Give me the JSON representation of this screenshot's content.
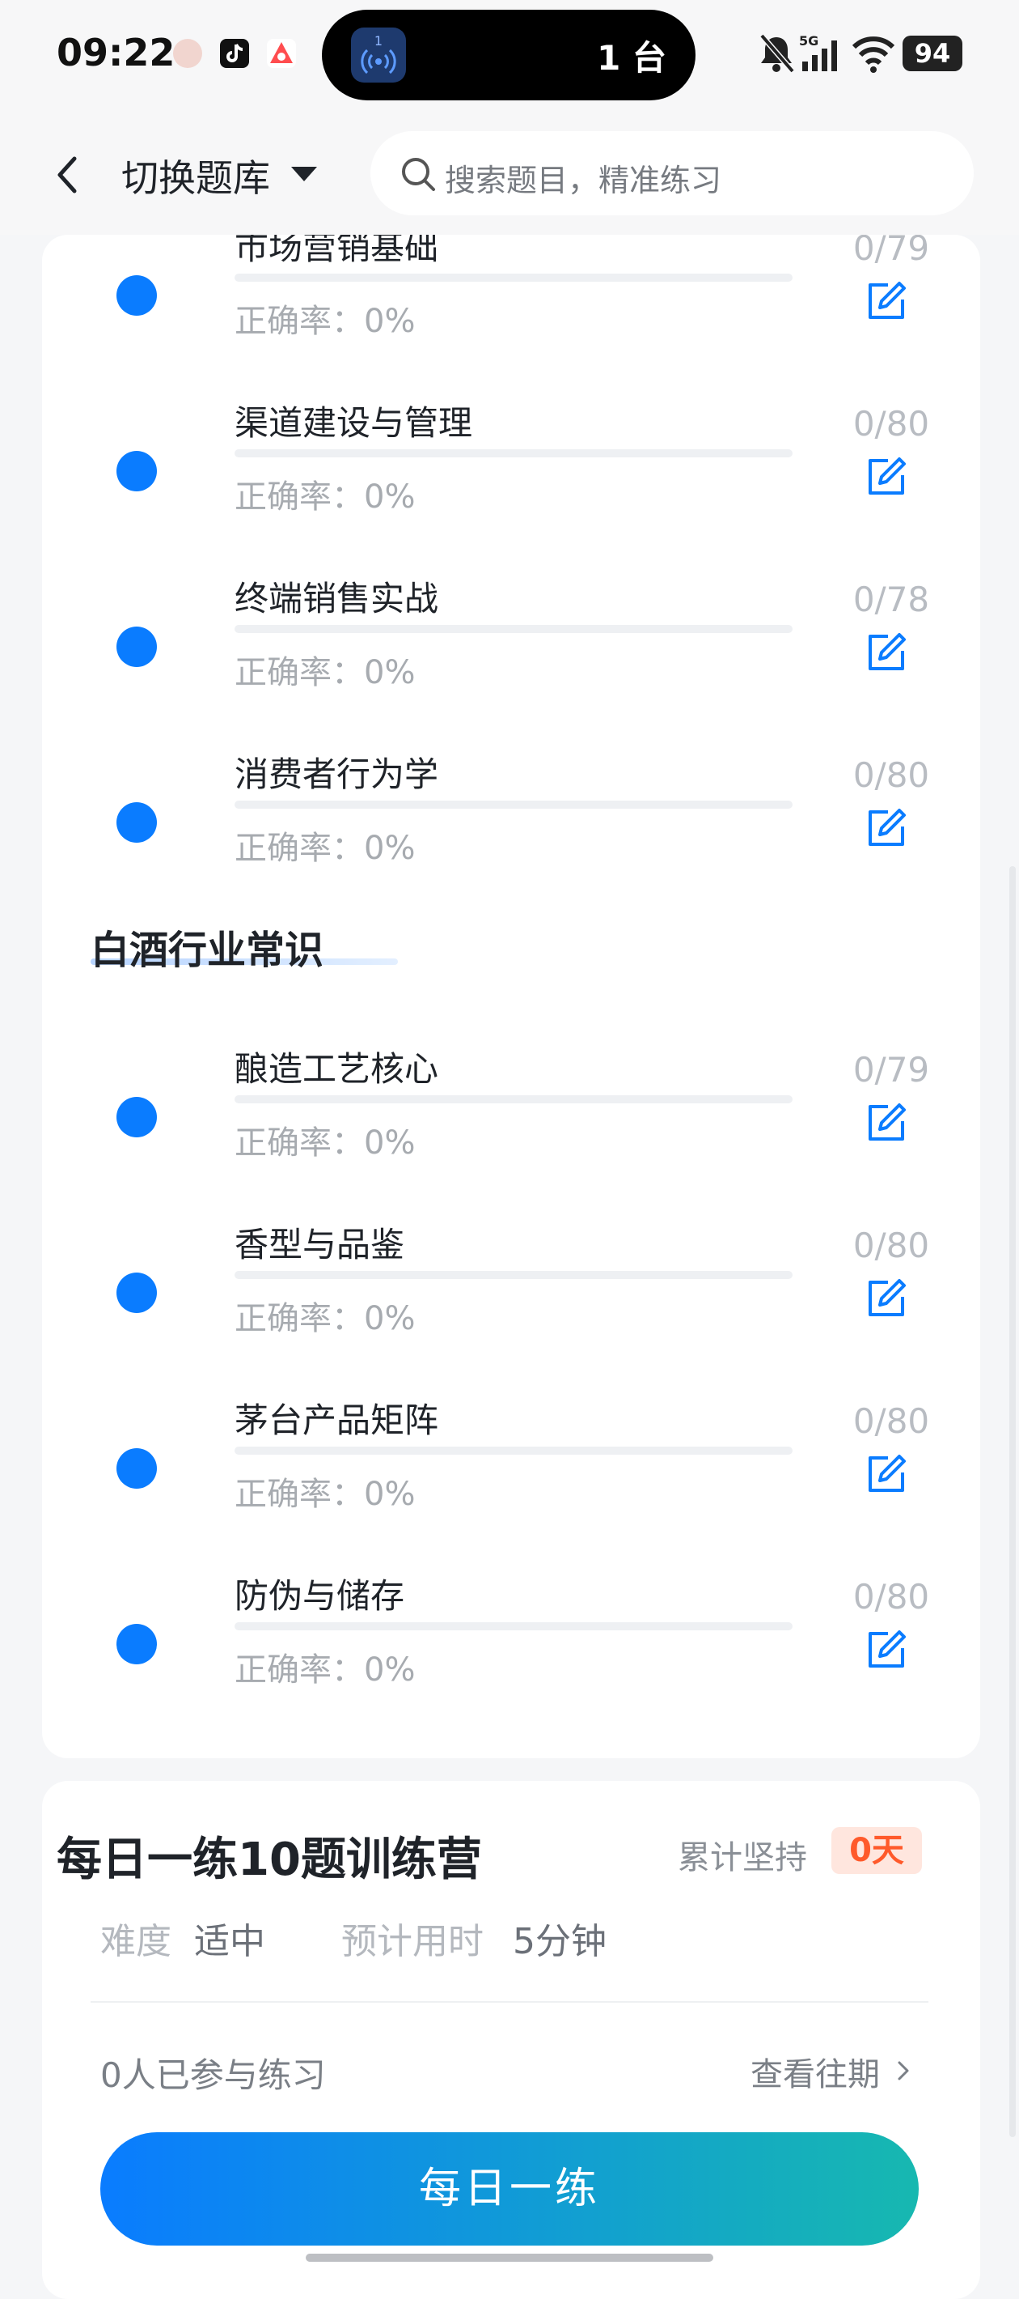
{
  "status_bar": {
    "time": "09:22",
    "island_text": "1 台",
    "island_badge": "1",
    "signal_label": "5G",
    "battery": "94"
  },
  "header": {
    "switch_label": "切换题库",
    "search_placeholder": "搜索题目，精准练习"
  },
  "topics_partial": [
    {
      "title": "市场营销基础",
      "accuracy_label": "正确率：0%",
      "count": "0/79"
    },
    {
      "title": "渠道建设与管理",
      "accuracy_label": "正确率：0%",
      "count": "0/80"
    },
    {
      "title": "终端销售实战",
      "accuracy_label": "正确率：0%",
      "count": "0/78"
    },
    {
      "title": "消费者行为学",
      "accuracy_label": "正确率：0%",
      "count": "0/80"
    }
  ],
  "section": {
    "title": "白酒行业常识",
    "items": [
      {
        "title": "酿造工艺核心",
        "accuracy_label": "正确率：0%",
        "count": "0/79"
      },
      {
        "title": "香型与品鉴",
        "accuracy_label": "正确率：0%",
        "count": "0/80"
      },
      {
        "title": "茅台产品矩阵",
        "accuracy_label": "正确率：0%",
        "count": "0/80"
      },
      {
        "title": "防伪与储存",
        "accuracy_label": "正确率：0%",
        "count": "0/80"
      }
    ]
  },
  "daily": {
    "title": "每日一练10题训练营",
    "persist_label": "累计坚持",
    "days": "0天",
    "difficulty_label": "难度",
    "difficulty_value": "适中",
    "time_label": "预计用时",
    "time_value": "5分钟",
    "participants": "0人已参与练习",
    "history_link": "查看往期",
    "button_label": "每日一练"
  },
  "colors": {
    "accent": "#0a7cff",
    "badge_text": "#ff5a2b",
    "badge_bg": "#ffe6de"
  }
}
